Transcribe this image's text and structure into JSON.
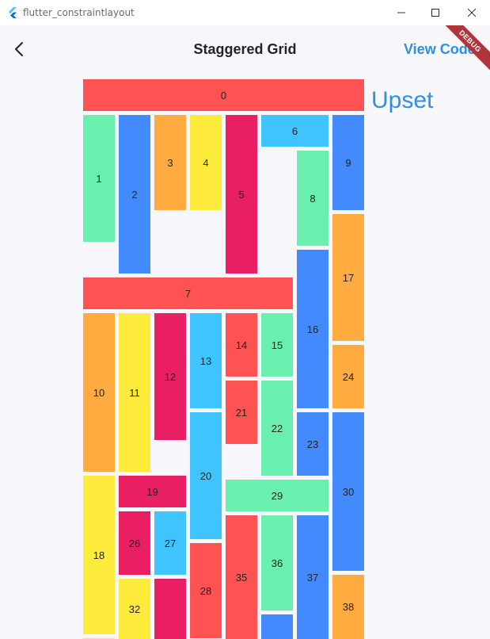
{
  "window": {
    "title": "flutter_constraintlayout"
  },
  "appbar": {
    "title": "Staggered Grid",
    "action": "View Code",
    "banner": "DEBUG"
  },
  "side_label": "Upset",
  "colors": {
    "red": "#ff5252",
    "green": "#69f0ae",
    "blue": "#448aff",
    "orange": "#ffab40",
    "yellow": "#ffeb3b",
    "pink": "#e91e63",
    "cyan": "#40c4ff",
    "accent": "#2d8fe6"
  },
  "tiles": [
    {
      "label": "0",
      "color": "red"
    },
    {
      "label": "1",
      "color": "green"
    },
    {
      "label": "2",
      "color": "blue"
    },
    {
      "label": "3",
      "color": "orange"
    },
    {
      "label": "4",
      "color": "yellow"
    },
    {
      "label": "5",
      "color": "pink"
    },
    {
      "label": "6",
      "color": "cyan"
    },
    {
      "label": "7",
      "color": "red"
    },
    {
      "label": "8",
      "color": "green"
    },
    {
      "label": "9",
      "color": "blue"
    },
    {
      "label": "10",
      "color": "orange"
    },
    {
      "label": "11",
      "color": "yellow"
    },
    {
      "label": "12",
      "color": "pink"
    },
    {
      "label": "13",
      "color": "cyan"
    },
    {
      "label": "14",
      "color": "red"
    },
    {
      "label": "15",
      "color": "green"
    },
    {
      "label": "16",
      "color": "blue"
    },
    {
      "label": "17",
      "color": "orange"
    },
    {
      "label": "18",
      "color": "yellow"
    },
    {
      "label": "19",
      "color": "pink"
    },
    {
      "label": "20",
      "color": "cyan"
    },
    {
      "label": "21",
      "color": "red"
    },
    {
      "label": "22",
      "color": "green"
    },
    {
      "label": "23",
      "color": "blue"
    },
    {
      "label": "24",
      "color": "orange"
    },
    {
      "label": "",
      "color": "yellow"
    },
    {
      "label": "26",
      "color": "pink"
    },
    {
      "label": "27",
      "color": "cyan"
    },
    {
      "label": "28",
      "color": "red"
    },
    {
      "label": "29",
      "color": "green"
    },
    {
      "label": "30",
      "color": "blue"
    },
    {
      "label": "",
      "color": "pink"
    },
    {
      "label": "32",
      "color": "yellow"
    },
    {
      "label": "35",
      "color": "red"
    },
    {
      "label": "36",
      "color": "green"
    },
    {
      "label": "37",
      "color": "blue"
    },
    {
      "label": "38",
      "color": "orange"
    },
    {
      "label": "",
      "color": "blue"
    }
  ]
}
